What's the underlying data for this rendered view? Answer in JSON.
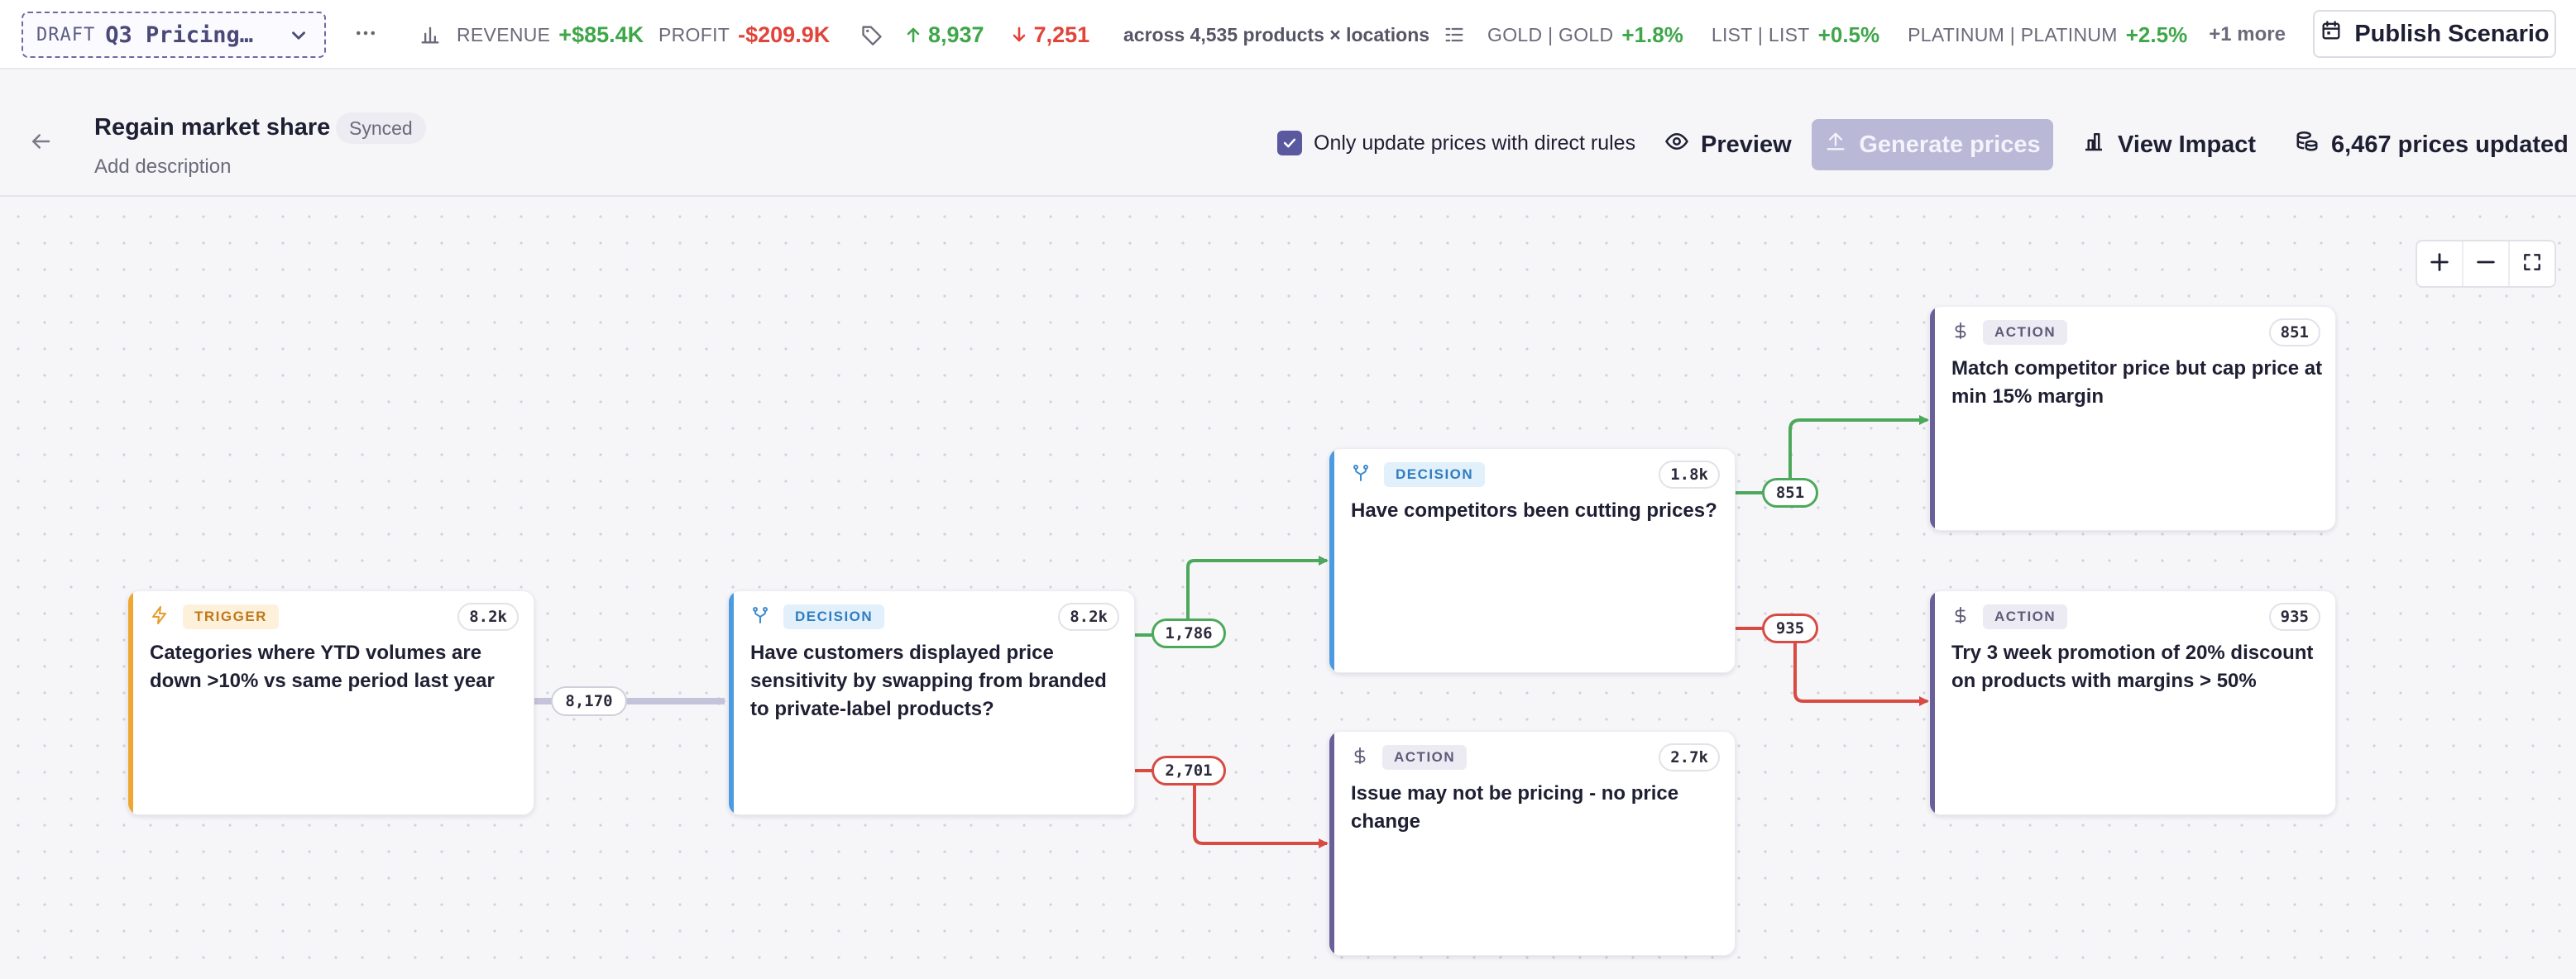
{
  "topbar": {
    "draft_label": "DRAFT",
    "scenario_name": "Q3 Pricing…",
    "revenue_label": "REVENUE",
    "revenue_value": "+$85.4K",
    "profit_label": "PROFIT",
    "profit_value": "-$209.9K",
    "price_up": "8,937",
    "price_down": "7,251",
    "scope_text": "across 4,535 products × locations",
    "lists": [
      {
        "label": "GOLD | GOLD",
        "value": "+1.8%"
      },
      {
        "label": "LIST | LIST",
        "value": "+0.5%"
      },
      {
        "label": "PLATINUM | PLATINUM",
        "value": "+2.5%"
      }
    ],
    "more_lists": "+1 more",
    "publish_label": "Publish Scenario"
  },
  "header": {
    "title": "Regain market share",
    "sync_status": "Synced",
    "add_description": "Add description",
    "checkbox_label": "Only update prices with direct rules",
    "checkbox_checked": true,
    "preview_label": "Preview",
    "generate_label": "Generate prices",
    "impact_label": "View Impact",
    "prices_updated": "6,467 prices updated"
  },
  "canvas": {
    "nodes": [
      {
        "type": "TRIGGER",
        "count": "8.2k",
        "text": "Categories where YTD volumes are down >10% vs same period last year"
      },
      {
        "type": "DECISION",
        "count": "8.2k",
        "text": "Have customers displayed price sensitivity by swapping from branded to private-label products?"
      },
      {
        "type": "DECISION",
        "count": "1.8k",
        "text": "Have competitors been cutting prices?"
      },
      {
        "type": "ACTION",
        "count": "2.7k",
        "text": "Issue may not be pricing - no price change"
      },
      {
        "type": "ACTION",
        "count": "851",
        "text": "Match competitor price but cap price at min 15% margin"
      },
      {
        "type": "ACTION",
        "count": "935",
        "text": "Try 3 week promotion of 20% discount on products with margins > 50%"
      }
    ],
    "edges": [
      {
        "label": "8,170",
        "kind": "neutral"
      },
      {
        "label": "1,786",
        "kind": "yes"
      },
      {
        "label": "2,701",
        "kind": "no"
      },
      {
        "label": "851",
        "kind": "yes"
      },
      {
        "label": "935",
        "kind": "no"
      }
    ]
  },
  "colors": {
    "accent": "#5a59a0",
    "positive": "#3fa64a",
    "negative": "#e0443a",
    "trigger": "#f0a732",
    "decision": "#4c9be0",
    "action": "#6a5f99"
  },
  "icons": [
    "chevron-down-icon",
    "more-horizontal-icon",
    "bar-chart-icon",
    "price-tag-icon",
    "arrow-up-icon",
    "arrow-down-icon",
    "list-icon",
    "calendar-icon",
    "arrow-left-icon",
    "check-icon",
    "eye-icon",
    "upload-icon",
    "coins-icon",
    "plus-icon",
    "minus-icon",
    "fullscreen-icon",
    "lightning-icon",
    "branch-icon",
    "dollar-icon"
  ]
}
